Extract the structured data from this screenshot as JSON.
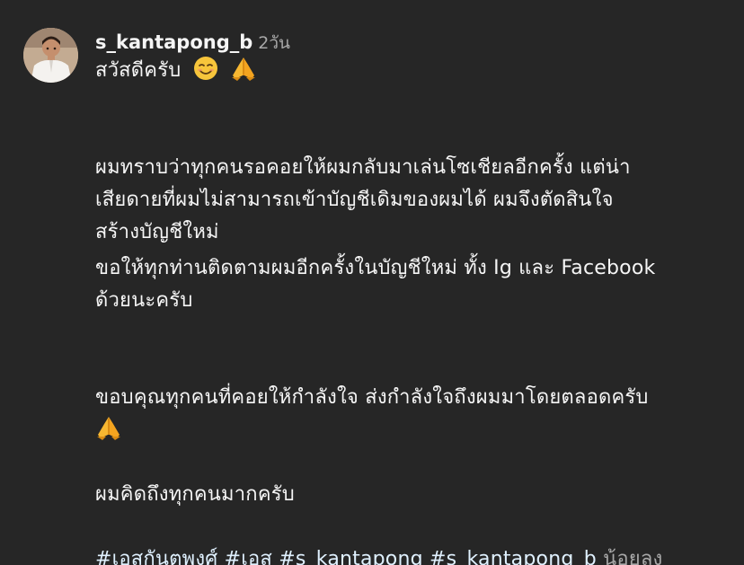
{
  "post": {
    "username": "s_kantapong_b",
    "timestamp": "2วัน",
    "greeting": "สวัสดีครับ",
    "paragraph1": [
      "ผมทราบว่าทุกคนรอคอยให้ผมกลับมาเล่นโซเชียลอีกครั้ง แต่น่า",
      "เสียดายที่ผมไม่สามารถเข้าบัญชีเดิมของผมได้ ผมจึงตัดสินใจ",
      "สร้างบัญชีใหม่"
    ],
    "paragraph2": [
      "ขอให้ทุกท่านติดตามผมอีกครั้งในบัญชีใหม่ ทั้ง Ig และ Facebook",
      "ด้วยนะครับ"
    ],
    "paragraph3": "ขอบคุณทุกคนที่คอยให้กำลังใจ ส่งกำลังใจถึงผมมาโดยตลอดครับ",
    "paragraph4": "ผมคิดถึงทุกคนมากครับ",
    "hashtags": [
      "#เอสกันตพงศ์",
      "#เอส",
      "#s_kantapong",
      "#s_kantapong_b"
    ],
    "less_label": "น้อยลง"
  },
  "icons": {
    "greeting_emojis": [
      "smiling-face-icon",
      "folded-hands-icon"
    ],
    "closing_emoji": "folded-hands-icon"
  },
  "colors": {
    "background": "#262626",
    "text": "#f5f5f5",
    "muted": "#a8a8a8",
    "hashtag": "#e0f1ff"
  }
}
